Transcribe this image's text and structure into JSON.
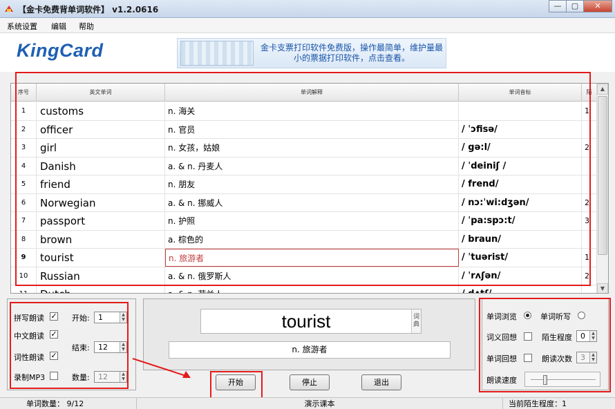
{
  "window": {
    "title": "【金卡免费背单词软件】 v1.2.0616",
    "minimize_label": "—",
    "maximize_label": "▢",
    "close_label": "✕"
  },
  "menu": [
    "系统设置",
    "编辑",
    "帮助"
  ],
  "banner": {
    "logo": "KingCard",
    "ad_text": "金卡支票打印软件免费版，操作最简单，维护量最小的票据打印软件，点击查看。"
  },
  "table": {
    "columns": [
      "序号",
      "英文单词",
      "单词解释",
      "单词音标",
      "陌"
    ],
    "rows": [
      {
        "no": "1",
        "word": "customs",
        "def": "n. 海关",
        "phon": "",
        "extra": "1"
      },
      {
        "no": "2",
        "word": "officer",
        "def": "n. 官员",
        "phon": "/ ˈɔfisə/",
        "extra": ""
      },
      {
        "no": "3",
        "word": "girl",
        "def": "n. 女孩，姑娘",
        "phon": "/ gə:l/",
        "extra": "2"
      },
      {
        "no": "4",
        "word": "Danish",
        "def": "a. & n. 丹麦人",
        "phon": "/ ˈdeiniʃ /",
        "extra": ""
      },
      {
        "no": "5",
        "word": "friend",
        "def": "n. 朋友",
        "phon": "/ frend/",
        "extra": ""
      },
      {
        "no": "6",
        "word": "Norwegian",
        "def": "a. & n. 挪威人",
        "phon": "/ nɔ:ˈwi:dʒən/",
        "extra": "2"
      },
      {
        "no": "7",
        "word": "passport",
        "def": "n. 护照",
        "phon": "/ ˈpa:spɔ:t/",
        "extra": "3"
      },
      {
        "no": "8",
        "word": "brown",
        "def": "a. 棕色的",
        "phon": "/ braun/",
        "extra": ""
      },
      {
        "no": "9",
        "word": "tourist",
        "def": "n. 旅游者",
        "phon": "/ ˈtuərist/",
        "extra": "1"
      },
      {
        "no": "10",
        "word": "Russian",
        "def": "a. & n. 俄罗斯人",
        "phon": "/ ˈrʌʃən/",
        "extra": "2"
      },
      {
        "no": "11",
        "word": "Dutch",
        "def": "a. & n. 荷兰人",
        "phon": "/ dʌtʃ/",
        "extra": ""
      }
    ]
  },
  "left_panel": {
    "spell_read": "拼写朗读",
    "chinese_read": "中文朗读",
    "pos_read": "词性朗读",
    "record_mp3": "录制MP3",
    "start_label": "开始:",
    "start_value": "1",
    "end_label": "结束:",
    "end_value": "12",
    "count_label": "数量:",
    "count_value": "12"
  },
  "center_panel": {
    "word": "tourist",
    "dict_label": "词典",
    "definition": "n. 旅游者"
  },
  "buttons": {
    "start": "开始",
    "stop": "停止",
    "exit": "退出"
  },
  "right_panel": {
    "browse": "单词浏览",
    "dictation": "单词听写",
    "meaning_recall": "词义回想",
    "word_recall": "单词回想",
    "strangeness_label": "陌生程度",
    "strangeness_value": "0",
    "read_times_label": "朗读次数",
    "read_times_value": "3",
    "read_speed_label": "朗读速度",
    "read_speed_level": 0.2
  },
  "status": {
    "word_count": "单词数量：  9/12",
    "course": "演示课本",
    "current_strangeness": "当前陌生程度：1"
  },
  "colors": {
    "highlight_red": "#e41a1a",
    "logo_blue": "#1e5fb4"
  }
}
